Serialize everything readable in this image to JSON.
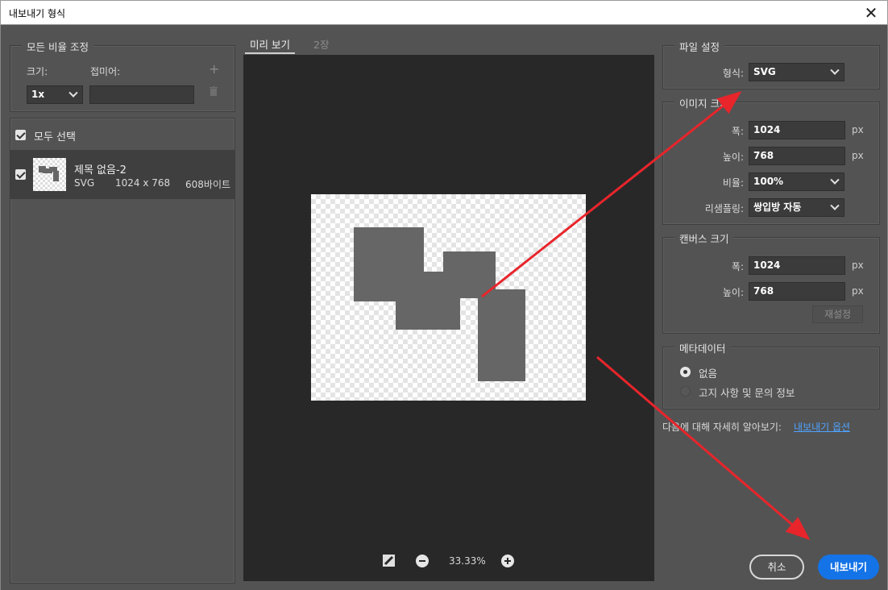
{
  "window": {
    "title": "내보내기 형식",
    "close_glyph": "✕"
  },
  "left": {
    "scale_group": {
      "legend": "모든 비율 조정",
      "size_label": "크기:",
      "suffix_label": "접미어:",
      "size_value": "1x",
      "suffix_value": ""
    },
    "select_all_label": "모두 선택",
    "item": {
      "name": "제목 없음-2",
      "format": "SVG",
      "dimensions": "1024 x 768",
      "filesize": "608바이트"
    }
  },
  "center": {
    "tabs": [
      "미리 보기",
      "2장"
    ],
    "zoom": "33.33%"
  },
  "right": {
    "file_settings": {
      "legend": "파일 설정",
      "format_label": "형식:",
      "format_value": "SVG"
    },
    "image_size": {
      "legend": "이미지 크기",
      "width_label": "폭:",
      "width_value": "1024",
      "width_unit": "px",
      "height_label": "높이:",
      "height_value": "768",
      "height_unit": "px",
      "scale_label": "비율:",
      "scale_value": "100%",
      "resample_label": "리샘플링:",
      "resample_value": "쌍입방 자동"
    },
    "canvas_size": {
      "legend": "캔버스 크기",
      "width_label": "폭:",
      "width_value": "1024",
      "width_unit": "px",
      "height_label": "높이:",
      "height_value": "768",
      "height_unit": "px",
      "reset_label": "재설정"
    },
    "metadata": {
      "legend": "메타데이터",
      "options": [
        "없음",
        "고지 사항 및 문의 정보"
      ],
      "selected_index": 0
    },
    "learn_more_text": "다음에 대해 자세히 알아보기:",
    "learn_more_link": "내보내기 옵션"
  },
  "buttons": {
    "cancel": "취소",
    "export": "내보내기"
  },
  "colors": {
    "accent": "#1473e6",
    "annotation_arrow": "#e8252b",
    "panel_bg": "#535353",
    "preview_bg": "#282828"
  }
}
